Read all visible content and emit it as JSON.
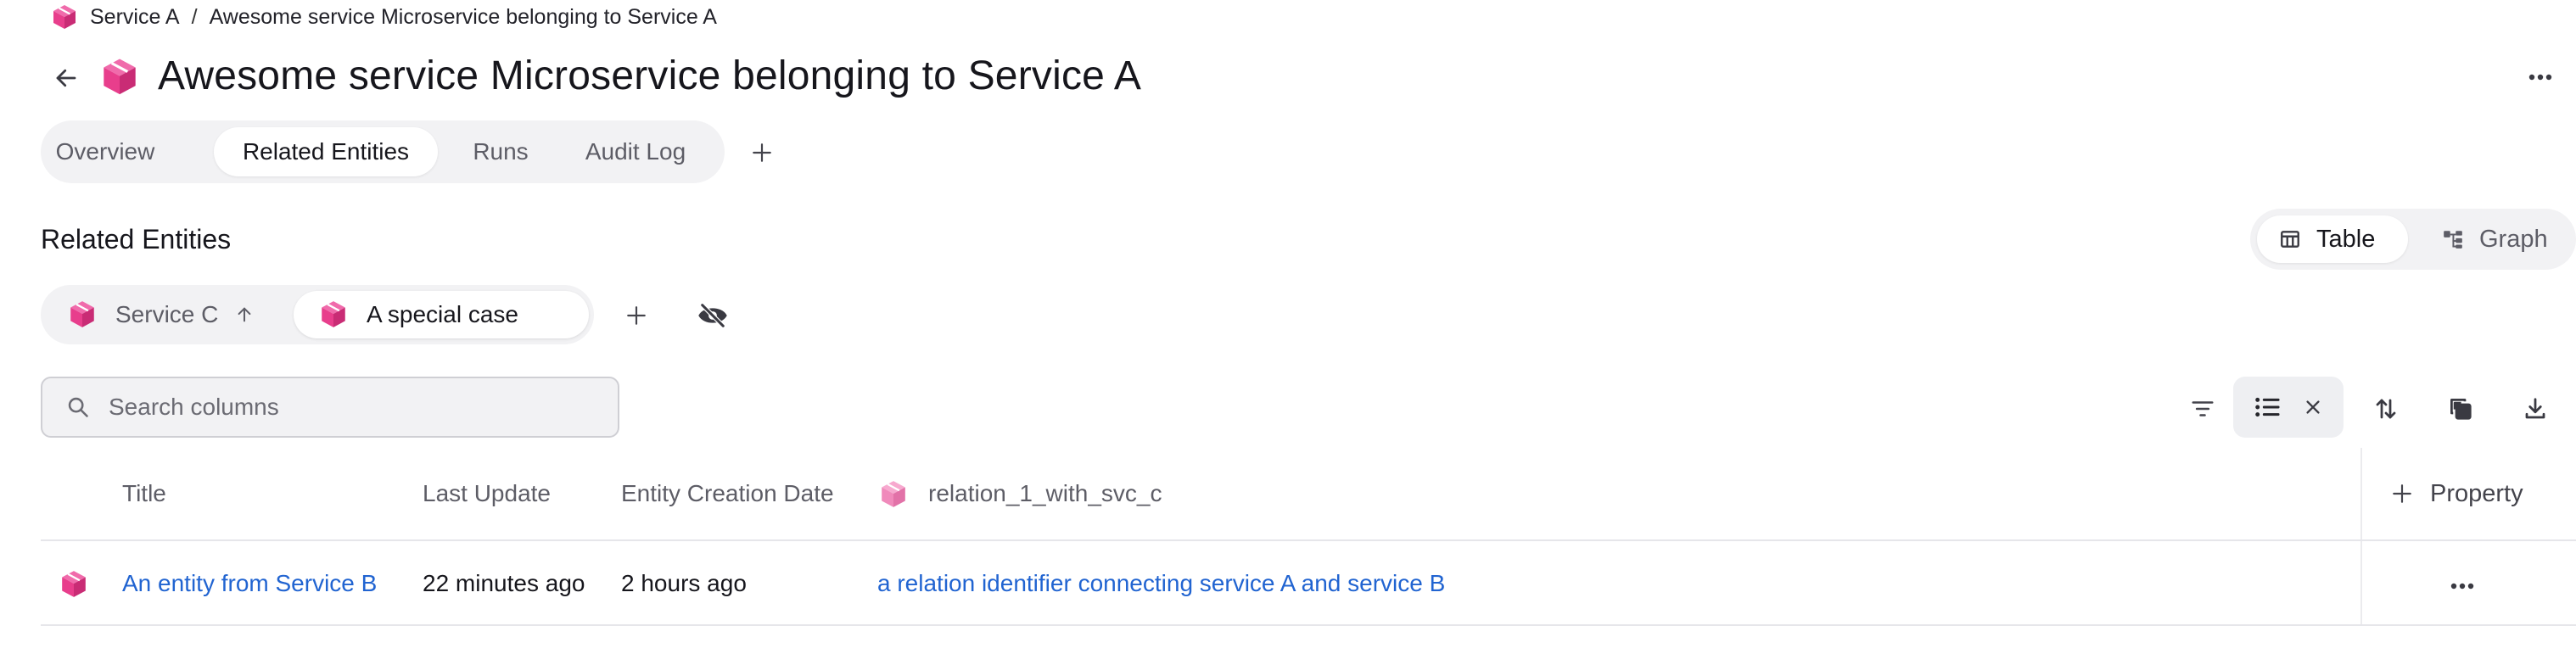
{
  "breadcrumb": {
    "items": [
      "Service A",
      "Awesome service Microservice belonging to Service A"
    ],
    "separator": "/"
  },
  "page": {
    "title": "Awesome service Microservice belonging to Service A"
  },
  "tabs": [
    {
      "label": "Overview",
      "active": false
    },
    {
      "label": "Related Entities",
      "active": true
    },
    {
      "label": "Runs",
      "active": false
    },
    {
      "label": "Audit Log",
      "active": false
    }
  ],
  "section": {
    "title": "Related Entities"
  },
  "view_toggle": {
    "table_label": "Table",
    "graph_label": "Graph",
    "selected": "Table"
  },
  "blueprint_chips": [
    {
      "label": "Service C",
      "icon": "arrow-up-icon",
      "active": false
    },
    {
      "label": "A special case",
      "active": true
    }
  ],
  "search": {
    "placeholder": "Search columns",
    "value": ""
  },
  "table": {
    "columns": [
      "Title",
      "Last Update",
      "Entity Creation Date",
      "relation_1_with_svc_c"
    ],
    "add_property_label": "Property",
    "rows": [
      {
        "title": "An entity from Service B",
        "last_update": "22 minutes ago",
        "creation_date": "2 hours ago",
        "relation": "a relation identifier connecting service A and service B"
      }
    ]
  },
  "colors": {
    "brand_pink": "#e83e8c",
    "link_blue": "#2164d1",
    "pill_background": "#f2f2f4"
  }
}
